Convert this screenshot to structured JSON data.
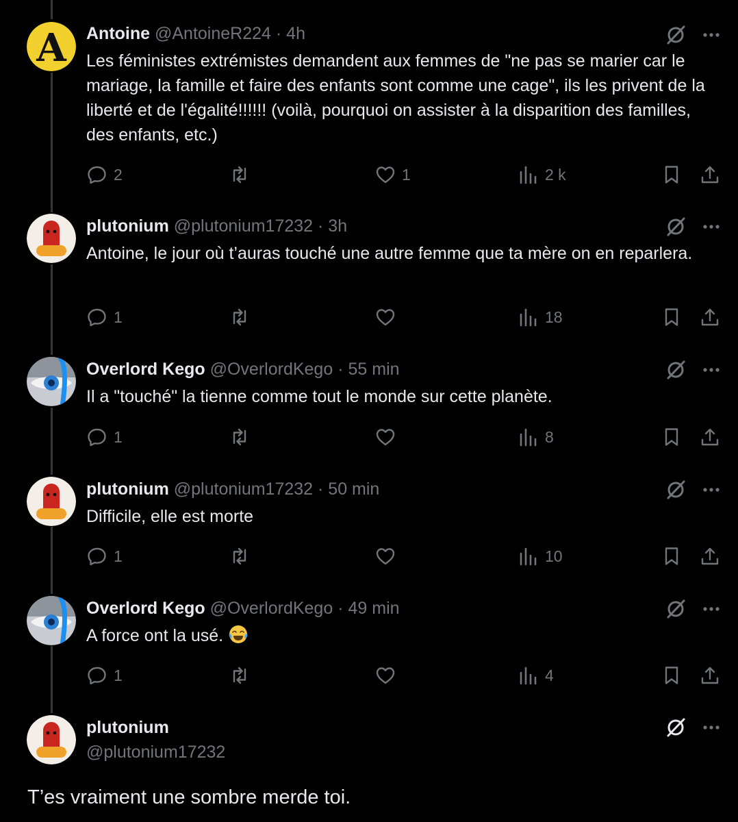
{
  "tweets": [
    {
      "name": "Antoine",
      "handle": "@AntoineR224",
      "sep": "·",
      "time": "4h",
      "text": "Les féministes extrémistes demandent aux femmes de \"ne pas se marier car le mariage, la famille et faire des enfants sont comme une cage\", ils les privent de la liberté et de l'égalité!!!!!! (voilà, pourquoi on assister à la disparition des familles, des enfants, etc.)",
      "replies": "2",
      "reposts": "",
      "likes": "1",
      "views": "2 k"
    },
    {
      "name": "plutonium",
      "handle": "@plutonium17232",
      "sep": "·",
      "time": "3h",
      "text": "Antoine, le jour où t’auras touché une autre femme que ta mère on en reparlera.",
      "replies": "1",
      "reposts": "",
      "likes": "",
      "views": "18"
    },
    {
      "name": "Overlord Kego",
      "handle": "@OverlordKego",
      "sep": "·",
      "time": "55 min",
      "text": "Il a \"touché\" la tienne comme tout le monde sur cette planète.",
      "replies": "1",
      "reposts": "",
      "likes": "",
      "views": "8"
    },
    {
      "name": "plutonium",
      "handle": "@plutonium17232",
      "sep": "·",
      "time": "50 min",
      "text": "Difficile, elle est morte",
      "replies": "1",
      "reposts": "",
      "likes": "",
      "views": "10"
    },
    {
      "name": "Overlord Kego",
      "handle": "@OverlordKego",
      "sep": "·",
      "time": "49 min",
      "text": "A force ont la usé.",
      "emoji": "face-with-tears-of-joy",
      "replies": "1",
      "reposts": "",
      "likes": "",
      "views": "4"
    }
  ],
  "main_tweet": {
    "name": "plutonium",
    "handle": "@plutonium17232",
    "text": "T’es vraiment une sombre merde toi."
  },
  "icons": {
    "reply": "reply-icon",
    "repost": "repost-icon",
    "like": "like-icon",
    "views": "views-icon",
    "bookmark": "bookmark-icon",
    "share": "share-icon",
    "grok": "grok-icon",
    "more": "more-icon"
  },
  "colors": {
    "background": "#000000",
    "text": "#e7e9ea",
    "muted": "#71767b",
    "thread_line": "#333639"
  }
}
